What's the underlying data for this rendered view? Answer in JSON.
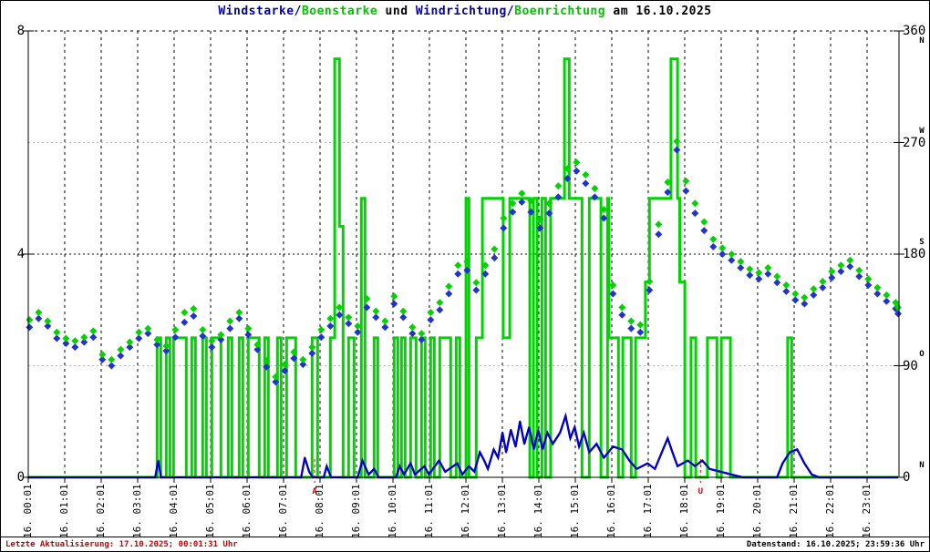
{
  "title": {
    "segments": [
      {
        "text": "Windstarke/",
        "color": "#0000a8"
      },
      {
        "text": "Boenstarke",
        "color": "#00c400"
      },
      {
        "text": " und ",
        "color": "#000000"
      },
      {
        "text": "Windrichtung/",
        "color": "#0000a8"
      },
      {
        "text": "Boenrichtung",
        "color": "#00c400"
      },
      {
        "text": " am 16.10.2025",
        "color": "#000000"
      }
    ]
  },
  "footer": {
    "last_update": "Letzte Aktualisierung: 17.10.2025; 00:01:31 Uhr",
    "data_state": "Datenstand: 16.10.2025; 23:59:36 Uhr"
  },
  "axes": {
    "left": {
      "min": 0,
      "max": 8,
      "labels": [
        {
          "v": 8,
          "text": "8"
        },
        {
          "v": 4,
          "text": "4"
        },
        {
          "v": 0,
          "text": "0"
        }
      ]
    },
    "right": {
      "min": 0,
      "max": 360,
      "labels": [
        {
          "v": 360,
          "text": "360",
          "compass": "N",
          "compass_side": "below"
        },
        {
          "v": 270,
          "text": "270",
          "compass": "W",
          "compass_side": "above"
        },
        {
          "v": 180,
          "text": "180",
          "compass": "S",
          "compass_side": "above"
        },
        {
          "v": 90,
          "text": "90",
          "compass": "O",
          "compass_side": "above"
        },
        {
          "v": 0,
          "text": "0",
          "compass": "N",
          "compass_side": "above"
        }
      ]
    },
    "x": {
      "labels": [
        "16. 00:01",
        "16. 01:01",
        "16. 02:01",
        "16. 03:01",
        "16. 04:01",
        "16. 05:01",
        "16. 06:01",
        "16. 07:01",
        "16. 08:01",
        "16. 09:01",
        "16. 10:01",
        "16. 11:01",
        "16. 12:01",
        "16. 13:01",
        "16. 14:01",
        "16. 15:01",
        "16. 16:01",
        "16. 17:01",
        "16. 18:01",
        "16. 19:01",
        "16. 20:01",
        "16. 21:01",
        "16. 22:01",
        "16. 23:01"
      ]
    }
  },
  "sun_markers": [
    {
      "label": "A",
      "hour": 7.87,
      "color": "#d40000"
    },
    {
      "label": "U",
      "hour": 18.45,
      "color": "#d40000"
    }
  ],
  "chart_data": {
    "type": "mixed",
    "title": "Windstarke/Boenstarke und Windrichtung/Boenrichtung am 16.10.2025",
    "left_axis": {
      "min": 0,
      "max": 8,
      "ticks": [
        0,
        4,
        8
      ]
    },
    "right_axis": {
      "min": 0,
      "max": 360,
      "ticks": [
        0,
        90,
        180,
        270,
        360
      ],
      "compass": [
        "N",
        "O",
        "S",
        "W",
        "N"
      ]
    },
    "x_axis": {
      "unit": "hours",
      "range": [
        0,
        24
      ],
      "grid": "hourly-dashed"
    },
    "gridlines": {
      "horizontal_black": [
        180
      ],
      "horizontal_gray": [
        90,
        270
      ],
      "vertical": "every hour",
      "top_border_dashed": true
    },
    "series": [
      {
        "name": "Windstarke",
        "type": "line",
        "axis": "left",
        "color": "#0000c8",
        "points": [
          [
            0,
            0
          ],
          [
            3.5,
            0
          ],
          [
            3.58,
            0.3
          ],
          [
            3.66,
            0
          ],
          [
            7.5,
            0
          ],
          [
            7.6,
            0.35
          ],
          [
            7.72,
            0.1
          ],
          [
            7.82,
            0
          ],
          [
            8.12,
            0
          ],
          [
            8.2,
            0.2
          ],
          [
            8.32,
            0
          ],
          [
            9.05,
            0
          ],
          [
            9.18,
            0.3
          ],
          [
            9.35,
            0.05
          ],
          [
            9.5,
            0.15
          ],
          [
            9.62,
            0
          ],
          [
            10.1,
            0
          ],
          [
            10.2,
            0.2
          ],
          [
            10.32,
            0.05
          ],
          [
            10.5,
            0.25
          ],
          [
            10.62,
            0.05
          ],
          [
            10.88,
            0.2
          ],
          [
            11.0,
            0.05
          ],
          [
            11.28,
            0.3
          ],
          [
            11.45,
            0.1
          ],
          [
            11.78,
            0.25
          ],
          [
            11.92,
            0.05
          ],
          [
            12.1,
            0.2
          ],
          [
            12.25,
            0.1
          ],
          [
            12.4,
            0.45
          ],
          [
            12.52,
            0.3
          ],
          [
            12.62,
            0.15
          ],
          [
            12.78,
            0.5
          ],
          [
            12.9,
            0.35
          ],
          [
            13.02,
            0.8
          ],
          [
            13.12,
            0.45
          ],
          [
            13.25,
            0.85
          ],
          [
            13.38,
            0.55
          ],
          [
            13.5,
            1.0
          ],
          [
            13.62,
            0.6
          ],
          [
            13.75,
            0.9
          ],
          [
            13.88,
            0.5
          ],
          [
            14.0,
            0.85
          ],
          [
            14.12,
            0.5
          ],
          [
            14.25,
            0.8
          ],
          [
            14.4,
            0.6
          ],
          [
            14.6,
            0.8
          ],
          [
            14.75,
            1.1
          ],
          [
            14.88,
            0.7
          ],
          [
            15.0,
            0.9
          ],
          [
            15.12,
            0.55
          ],
          [
            15.25,
            0.8
          ],
          [
            15.4,
            0.45
          ],
          [
            15.6,
            0.6
          ],
          [
            15.8,
            0.35
          ],
          [
            16.05,
            0.55
          ],
          [
            16.3,
            0.5
          ],
          [
            16.5,
            0.3
          ],
          [
            16.7,
            0.15
          ],
          [
            17.0,
            0.25
          ],
          [
            17.2,
            0.15
          ],
          [
            17.55,
            0.7
          ],
          [
            17.68,
            0.45
          ],
          [
            17.82,
            0.2
          ],
          [
            18.1,
            0.3
          ],
          [
            18.3,
            0.2
          ],
          [
            18.5,
            0.3
          ],
          [
            18.7,
            0.15
          ],
          [
            19.0,
            0.1
          ],
          [
            19.3,
            0.05
          ],
          [
            19.6,
            0
          ],
          [
            20.55,
            0
          ],
          [
            20.7,
            0.25
          ],
          [
            20.9,
            0.45
          ],
          [
            21.1,
            0.5
          ],
          [
            21.3,
            0.25
          ],
          [
            21.5,
            0.05
          ],
          [
            21.7,
            0
          ],
          [
            23.95,
            0
          ]
        ]
      },
      {
        "name": "Boenrichtung (Linie)",
        "type": "step",
        "axis": "right",
        "color": "#00d400",
        "points": [
          [
            0,
            0
          ],
          [
            3.55,
            112.5
          ],
          [
            3.65,
            0
          ],
          [
            3.8,
            112.5
          ],
          [
            3.9,
            0
          ],
          [
            4.0,
            112.5
          ],
          [
            4.35,
            0
          ],
          [
            4.5,
            112.5
          ],
          [
            4.6,
            0
          ],
          [
            4.8,
            112.5
          ],
          [
            4.9,
            0
          ],
          [
            5.05,
            112.5
          ],
          [
            5.3,
            0
          ],
          [
            5.5,
            112.5
          ],
          [
            5.6,
            0
          ],
          [
            5.8,
            112.5
          ],
          [
            5.9,
            0
          ],
          [
            6.05,
            112.5
          ],
          [
            6.35,
            0
          ],
          [
            6.5,
            112.5
          ],
          [
            6.6,
            0
          ],
          [
            6.85,
            112.5
          ],
          [
            6.95,
            0
          ],
          [
            7.1,
            112.5
          ],
          [
            7.35,
            0
          ],
          [
            7.8,
            112.5
          ],
          [
            7.95,
            0
          ],
          [
            8.3,
            112.5
          ],
          [
            8.42,
            337.5
          ],
          [
            8.55,
            202.5
          ],
          [
            8.65,
            0
          ],
          [
            8.8,
            112.5
          ],
          [
            8.95,
            0
          ],
          [
            9.15,
            225
          ],
          [
            9.25,
            0
          ],
          [
            9.5,
            112.5
          ],
          [
            9.6,
            0
          ],
          [
            10.05,
            112.5
          ],
          [
            10.15,
            0
          ],
          [
            10.25,
            112.5
          ],
          [
            10.35,
            0
          ],
          [
            10.5,
            112.5
          ],
          [
            10.65,
            0
          ],
          [
            10.8,
            112.5
          ],
          [
            10.9,
            0
          ],
          [
            11.05,
            112.5
          ],
          [
            11.15,
            0
          ],
          [
            11.3,
            112.5
          ],
          [
            11.6,
            0
          ],
          [
            11.75,
            112.5
          ],
          [
            11.85,
            0
          ],
          [
            12.02,
            225
          ],
          [
            12.1,
            0
          ],
          [
            12.3,
            112.5
          ],
          [
            12.47,
            225
          ],
          [
            13.04,
            112.5
          ],
          [
            13.22,
            225
          ],
          [
            13.77,
            0
          ],
          [
            13.87,
            225
          ],
          [
            13.97,
            0
          ],
          [
            14.1,
            225
          ],
          [
            14.2,
            0
          ],
          [
            14.34,
            225
          ],
          [
            14.72,
            337.5
          ],
          [
            14.85,
            225
          ],
          [
            15.2,
            0
          ],
          [
            15.4,
            225
          ],
          [
            15.72,
            0
          ],
          [
            15.9,
            225
          ],
          [
            15.94,
            112.5
          ],
          [
            16.2,
            0
          ],
          [
            16.32,
            112.5
          ],
          [
            16.55,
            0
          ],
          [
            16.67,
            112.5
          ],
          [
            16.94,
            157.5
          ],
          [
            17.05,
            225
          ],
          [
            17.64,
            337.5
          ],
          [
            17.82,
            225
          ],
          [
            17.88,
            157.5
          ],
          [
            18.02,
            0
          ],
          [
            18.19,
            112.5
          ],
          [
            18.32,
            0
          ],
          [
            18.64,
            112.5
          ],
          [
            18.9,
            0
          ],
          [
            19.02,
            112.5
          ],
          [
            19.27,
            0
          ],
          [
            20.84,
            112.5
          ],
          [
            20.95,
            0
          ]
        ]
      },
      {
        "name": "Windrichtung",
        "type": "scatter",
        "axis": "right",
        "color": "#2233cc",
        "marker": "diamond",
        "points_ref": "direction_points",
        "value_index": 1
      },
      {
        "name": "Boenrichtung (Punkte)",
        "type": "scatter",
        "axis": "right",
        "color": "#00d400",
        "marker": "diamond",
        "points_ref": "direction_points",
        "value_index": 2
      }
    ],
    "direction_points": [
      [
        0.05,
        121,
        127
      ],
      [
        0.3,
        128,
        133
      ],
      [
        0.55,
        122,
        126
      ],
      [
        0.8,
        112,
        117
      ],
      [
        1.05,
        108,
        112
      ],
      [
        1.3,
        105,
        110
      ],
      [
        1.55,
        109,
        113
      ],
      [
        1.8,
        113,
        118
      ],
      [
        2.05,
        95,
        99
      ],
      [
        2.3,
        90,
        95
      ],
      [
        2.55,
        98,
        103
      ],
      [
        2.8,
        105,
        109
      ],
      [
        3.05,
        112,
        117
      ],
      [
        3.3,
        116,
        120
      ],
      [
        3.55,
        107,
        111
      ],
      [
        3.8,
        102,
        106
      ],
      [
        4.05,
        113,
        119
      ],
      [
        4.3,
        125,
        133
      ],
      [
        4.55,
        130,
        136
      ],
      [
        4.8,
        114,
        119
      ],
      [
        5.05,
        105,
        110
      ],
      [
        5.3,
        111,
        115
      ],
      [
        5.55,
        120,
        126
      ],
      [
        5.8,
        128,
        133
      ],
      [
        6.05,
        115,
        120
      ],
      [
        6.3,
        103,
        107
      ],
      [
        6.55,
        89,
        94
      ],
      [
        6.8,
        77,
        81
      ],
      [
        7.05,
        86,
        91
      ],
      [
        7.3,
        96,
        101
      ],
      [
        7.55,
        91,
        95
      ],
      [
        7.8,
        100,
        105
      ],
      [
        8.05,
        113,
        119
      ],
      [
        8.3,
        122,
        128
      ],
      [
        8.55,
        131,
        137
      ],
      [
        8.8,
        124,
        129
      ],
      [
        9.05,
        117,
        122
      ],
      [
        9.3,
        137,
        144
      ],
      [
        9.55,
        129,
        134
      ],
      [
        9.8,
        121,
        126
      ],
      [
        10.05,
        140,
        146
      ],
      [
        10.3,
        129,
        134
      ],
      [
        10.55,
        116,
        121
      ],
      [
        10.8,
        111,
        116
      ],
      [
        11.05,
        127,
        133
      ],
      [
        11.3,
        135,
        141
      ],
      [
        11.55,
        148,
        154
      ],
      [
        11.8,
        164,
        171
      ],
      [
        12.05,
        167,
        174
      ],
      [
        12.3,
        151,
        157
      ],
      [
        12.55,
        164,
        171
      ],
      [
        12.8,
        177,
        184
      ],
      [
        13.05,
        201,
        209
      ],
      [
        13.3,
        214,
        221
      ],
      [
        13.55,
        222,
        229
      ],
      [
        13.8,
        214,
        223
      ],
      [
        14.05,
        201,
        208
      ],
      [
        14.3,
        213,
        221
      ],
      [
        14.55,
        226,
        235
      ],
      [
        14.8,
        241,
        249
      ],
      [
        15.05,
        247,
        254
      ],
      [
        15.3,
        237,
        244
      ],
      [
        15.55,
        226,
        233
      ],
      [
        15.8,
        209,
        216
      ],
      [
        16.05,
        148,
        155
      ],
      [
        16.3,
        131,
        137
      ],
      [
        16.55,
        120,
        126
      ],
      [
        16.8,
        117,
        123
      ],
      [
        17.05,
        151,
        158
      ],
      [
        17.3,
        196,
        204
      ],
      [
        17.55,
        230,
        238
      ],
      [
        17.8,
        264,
        271
      ],
      [
        18.05,
        231,
        239
      ],
      [
        18.3,
        213,
        221
      ],
      [
        18.55,
        199,
        206
      ],
      [
        18.8,
        186,
        192
      ],
      [
        19.05,
        180,
        185
      ],
      [
        19.3,
        175,
        180
      ],
      [
        19.55,
        169,
        174
      ],
      [
        19.8,
        163,
        168
      ],
      [
        20.05,
        160,
        165
      ],
      [
        20.3,
        164,
        169
      ],
      [
        20.55,
        157,
        162
      ],
      [
        20.8,
        150,
        155
      ],
      [
        21.05,
        143,
        148
      ],
      [
        21.3,
        140,
        145
      ],
      [
        21.55,
        147,
        152
      ],
      [
        21.8,
        153,
        158
      ],
      [
        22.05,
        161,
        166
      ],
      [
        22.3,
        166,
        171
      ],
      [
        22.55,
        170,
        175
      ],
      [
        22.8,
        162,
        167
      ],
      [
        23.05,
        155,
        160
      ],
      [
        23.3,
        148,
        153
      ],
      [
        23.55,
        142,
        147
      ],
      [
        23.8,
        136,
        141
      ],
      [
        23.95,
        132,
        137
      ]
    ]
  }
}
